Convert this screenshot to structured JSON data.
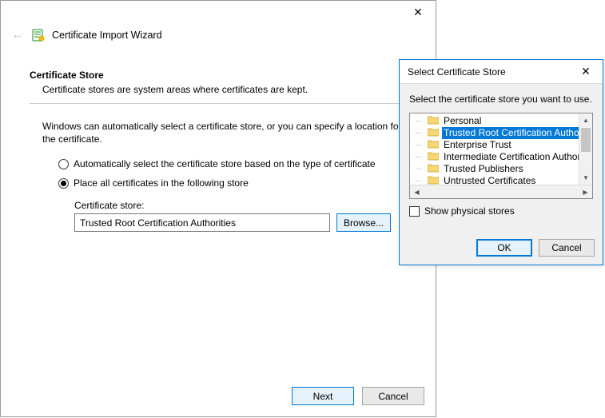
{
  "wizard": {
    "title": "Certificate Import Wizard",
    "section_title": "Certificate Store",
    "section_sub": "Certificate stores are system areas where certificates are kept.",
    "paragraph": "Windows can automatically select a certificate store, or you can specify a location for the certificate.",
    "radio_auto": "Automatically select the certificate store based on the type of certificate",
    "radio_place": "Place all certificates in the following store",
    "store_label": "Certificate store:",
    "store_value": "Trusted Root Certification Authorities",
    "browse": "Browse...",
    "next": "Next",
    "cancel": "Cancel"
  },
  "dialog": {
    "title": "Select Certificate Store",
    "prompt": "Select the certificate store you want to use.",
    "items": [
      "Personal",
      "Trusted Root Certification Authorities",
      "Enterprise Trust",
      "Intermediate Certification Authorities",
      "Trusted Publishers",
      "Untrusted Certificates"
    ],
    "selected_index": 1,
    "show_physical": "Show physical stores",
    "ok": "OK",
    "cancel": "Cancel"
  }
}
